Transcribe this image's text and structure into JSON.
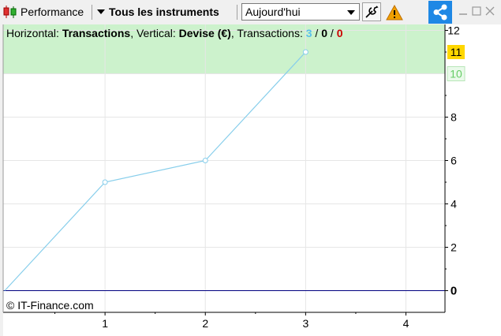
{
  "toolbar": {
    "performance_label": "Performance",
    "instrument_label": "Tous les instruments",
    "period_value": "Aujourd'hui"
  },
  "header": {
    "h_prefix": "Horizontal: ",
    "h_value": "Transactions",
    "v_prefix": ", Vertical: ",
    "v_value": "Devise (€)",
    "t_prefix": ", Transactions: ",
    "t_win": "3",
    "t_sep1": " / ",
    "t_neutral": "0",
    "t_sep2": " / ",
    "t_loss": "0"
  },
  "copyright": "© IT-Finance.com",
  "colors": {
    "line": "#87ceeb",
    "zero_line": "#000080",
    "target_zone": "#ccf2cc",
    "target_line": "#66cc66",
    "current_badge": "#ffd700",
    "win": "#5bc0eb",
    "loss": "#cc0000"
  },
  "chart_data": {
    "type": "line",
    "x": [
      0,
      1,
      2,
      3
    ],
    "y": [
      0,
      5,
      6,
      11
    ],
    "xlim": [
      0,
      4.4
    ],
    "ylim": [
      -1,
      12
    ],
    "x_ticks": [
      1,
      2,
      3,
      4
    ],
    "y_ticks": [
      0,
      2,
      4,
      6,
      8,
      10,
      12
    ],
    "target_value": 10,
    "current_value": 11,
    "grid": true,
    "xlabel": "Transactions",
    "ylabel": "Devise (€)"
  }
}
